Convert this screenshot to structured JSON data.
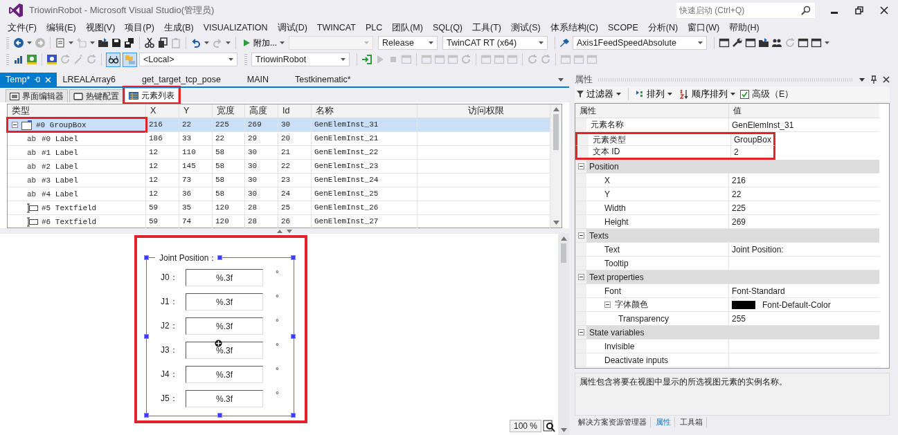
{
  "window": {
    "title": "TriowinRobot - Microsoft Visual Studio(管理员)",
    "quick_launch": {
      "placeholder": "快速启动 (Ctrl+Q)"
    }
  },
  "menu": [
    "文件(F)",
    "编辑(E)",
    "视图(V)",
    "项目(P)",
    "生成(B)",
    "VISUALIZATION",
    "调试(D)",
    "TWINCAT",
    "PLC",
    "团队(M)",
    "SQL(Q)",
    "工具(T)",
    "测试(S)",
    "体系结构(C)",
    "SCOPE",
    "分析(N)",
    "窗口(W)",
    "帮助(H)"
  ],
  "toolbar_1": {
    "attach_button": "附加...",
    "combos": [
      {
        "disabled": true
      },
      {
        "value": "Release",
        "disabled": false
      },
      {
        "value": "TwinCAT RT (x64)",
        "disabled": false
      },
      {
        "value": "Axis1FeedSpeedAbsolute",
        "disabled": false
      }
    ]
  },
  "toolbar_2": {
    "toggles": [
      {
        "on": true
      },
      {
        "on": true
      }
    ],
    "combos": [
      {
        "value": "<Local>"
      },
      {
        "value": "TriowinRobot"
      }
    ]
  },
  "document_tabs": [
    {
      "label": "Temp*",
      "selected": true
    },
    {
      "label": "LREALArray6",
      "selected": false
    },
    {
      "label": "get_target_tcp_pose",
      "selected": false
    },
    {
      "label": "MAIN",
      "selected": false
    },
    {
      "label": "Testkinematic*",
      "selected": false
    }
  ],
  "editor_tabs": [
    {
      "label": "界面编辑器",
      "selected": false,
      "highlighted": false
    },
    {
      "label": "热键配置",
      "selected": false,
      "highlighted": false
    },
    {
      "label": "元素列表",
      "selected": true,
      "highlighted": true
    }
  ],
  "element_table": {
    "columns": [
      "类型",
      "X",
      "Y",
      "宽度",
      "高度",
      "Id",
      "名称",
      "访问权限"
    ],
    "rows": [
      {
        "kind": "groupbox",
        "cells": [
          "#0 GroupBox",
          "216",
          "22",
          "225",
          "269",
          "30",
          "GenElemInst_31"
        ],
        "selected": true,
        "expanded": true,
        "highlighted": true,
        "children": [
          {
            "kind": "label",
            "icon_text": "ab",
            "cells": [
              "#0 Label",
              "186",
              "33",
              "22",
              "29",
              "20",
              "GenElemInst_21"
            ],
            "selected": false,
            "highlighted": false
          },
          {
            "kind": "label",
            "icon_text": "ab",
            "cells": [
              "#1 Label",
              "12",
              "110",
              "58",
              "30",
              "21",
              "GenElemInst_22"
            ],
            "selected": false,
            "highlighted": false
          },
          {
            "kind": "label",
            "icon_text": "ab",
            "cells": [
              "#2 Label",
              "12",
              "145",
              "58",
              "30",
              "22",
              "GenElemInst_23"
            ],
            "selected": false,
            "highlighted": false
          },
          {
            "kind": "label",
            "icon_text": "ab",
            "cells": [
              "#3 Label",
              "12",
              "73",
              "58",
              "30",
              "23",
              "GenElemInst_24"
            ],
            "selected": false,
            "highlighted": false
          },
          {
            "kind": "label",
            "icon_text": "ab",
            "cells": [
              "#4 Label",
              "12",
              "36",
              "58",
              "30",
              "24",
              "GenElemInst_25"
            ],
            "selected": false,
            "highlighted": false
          },
          {
            "kind": "textfield",
            "cells": [
              "#5 Textfield",
              "59",
              "35",
              "120",
              "28",
              "25",
              "GenElemInst_26"
            ],
            "selected": false,
            "highlighted": false
          },
          {
            "kind": "textfield",
            "cells": [
              "#6 Textfield",
              "59",
              "74",
              "120",
              "28",
              "26",
              "GenElemInst_27"
            ],
            "selected": false,
            "highlighted": false
          }
        ]
      }
    ]
  },
  "designer": {
    "highlighted": true,
    "selected": true,
    "group_title": "Joint Position：",
    "rows": [
      {
        "label": "J0：",
        "value": "%.3f",
        "unit": "°"
      },
      {
        "label": "J1：",
        "value": "%.3f",
        "unit": "°"
      },
      {
        "label": "J2：",
        "value": "%.3f",
        "unit": "°"
      },
      {
        "label": "J3：",
        "value": "%.3f",
        "unit": "°"
      },
      {
        "label": "J4：",
        "value": "%.3f",
        "unit": "°"
      },
      {
        "label": "J5：",
        "value": "%.3f",
        "unit": "°"
      }
    ],
    "zoom": "100 %"
  },
  "properties": {
    "title": "属性",
    "toolbar": [
      {
        "kind": "menu",
        "label": "过滤器"
      },
      {
        "kind": "menu",
        "label": "排列"
      },
      {
        "kind": "menu",
        "label": "顺序排列"
      },
      {
        "kind": "checkbox",
        "label": "高级（E）",
        "checked": true
      }
    ],
    "columns": [
      "属性",
      "值"
    ],
    "rows": [
      {
        "kind": "property",
        "name": "元素名称",
        "value": "GenElemInst_31",
        "highlighted": false
      },
      {
        "kind": "property",
        "name": "元素类型",
        "value": "GroupBox",
        "highlighted": true
      },
      {
        "kind": "property",
        "name": "文本 ID",
        "value": "2",
        "highlighted": true
      },
      {
        "kind": "category",
        "name": "Position",
        "expanded": true,
        "children": [
          {
            "kind": "property",
            "name": "X",
            "value": "216",
            "highlighted": false
          },
          {
            "kind": "property",
            "name": "Y",
            "value": "22",
            "highlighted": false
          },
          {
            "kind": "property",
            "name": "Width",
            "value": "225",
            "highlighted": false
          },
          {
            "kind": "property",
            "name": "Height",
            "value": "269",
            "highlighted": false
          }
        ]
      },
      {
        "kind": "category",
        "name": "Texts",
        "expanded": true,
        "children": [
          {
            "kind": "property",
            "name": "Text",
            "value": "Joint Position:",
            "highlighted": false
          },
          {
            "kind": "property",
            "name": "Tooltip",
            "highlighted": false
          }
        ]
      },
      {
        "kind": "category",
        "name": "Text properties",
        "expanded": true,
        "children": [
          {
            "kind": "property",
            "name": "Font",
            "value": "Font-Standard",
            "highlighted": false
          },
          {
            "kind": "color",
            "name": "字体颜色",
            "color": "#000000",
            "value": "Font-Default-Color",
            "expanded": true,
            "highlighted": false,
            "children": [
              {
                "kind": "property",
                "name": "Transparency",
                "value": "255",
                "highlighted": false
              }
            ]
          }
        ]
      },
      {
        "kind": "category",
        "name": "State variables",
        "expanded": true,
        "children": [
          {
            "kind": "property",
            "name": "Invisible",
            "highlighted": false
          },
          {
            "kind": "property",
            "name": "Deactivate inputs",
            "highlighted": false
          }
        ]
      }
    ],
    "description": "属性包含将要在视图中显示的所选视图元素的实例名称。",
    "bottom_tabs": [
      {
        "label": "解决方案资源管理器",
        "selected": false
      },
      {
        "label": "属性",
        "selected": true
      },
      {
        "label": "工具箱",
        "selected": false
      }
    ]
  }
}
